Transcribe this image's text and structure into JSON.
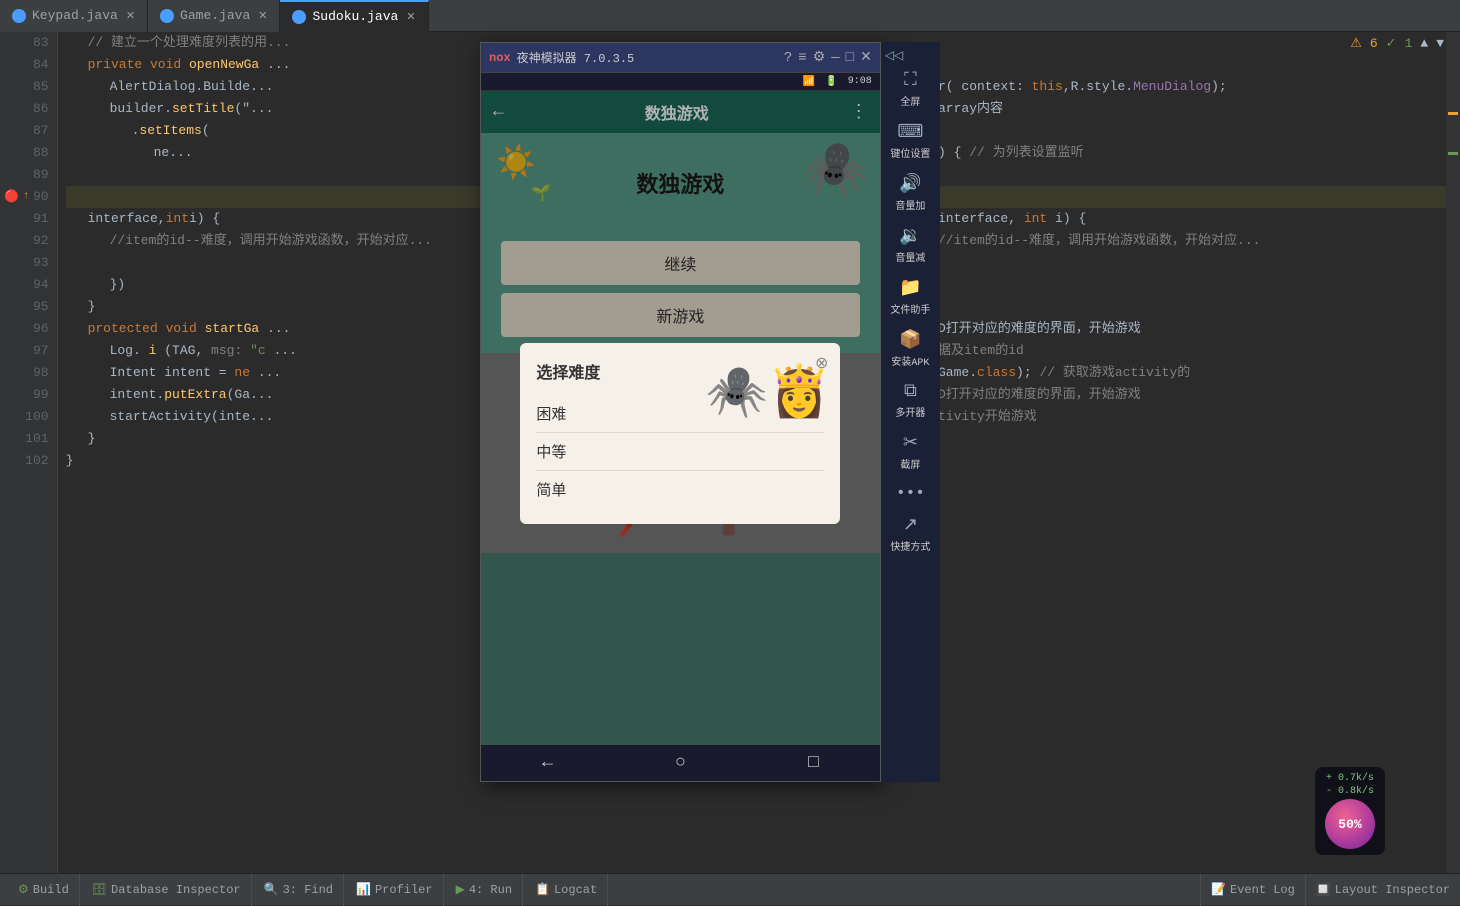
{
  "tabs": [
    {
      "label": "Keypad.java",
      "active": false,
      "id": "keypad"
    },
    {
      "label": "Game.java",
      "active": false,
      "id": "game"
    },
    {
      "label": "Sudoku.java",
      "active": true,
      "id": "sudoku"
    }
  ],
  "code": {
    "lines": [
      {
        "num": 83,
        "content": "    // 建立一个处理难度列表的用...",
        "type": "comment"
      },
      {
        "num": 84,
        "content": "    private void openNewGa...",
        "type": "code"
      },
      {
        "num": 85,
        "content": "        AlertDialog.Builde...",
        "type": "code"
      },
      {
        "num": 86,
        "content": "        builder.setTitle(\"...",
        "type": "code"
      },
      {
        "num": 87,
        "content": "            .setItems(",
        "type": "code"
      },
      {
        "num": 88,
        "content": "                ne...",
        "type": "code"
      },
      {
        "num": 89,
        "content": "",
        "type": "empty"
      },
      {
        "num": 90,
        "content": "",
        "type": "code",
        "highlighted": true
      },
      {
        "num": 91,
        "content": "    interface, int i) {",
        "type": "code"
      },
      {
        "num": 92,
        "content": "            //item的id--难度，调用开始游戏函数，开始对应...",
        "type": "comment"
      },
      {
        "num": 93,
        "content": "",
        "type": "empty"
      },
      {
        "num": 94,
        "content": "            })",
        "type": "code"
      },
      {
        "num": 95,
        "content": "    }",
        "type": "code"
      },
      {
        "num": 96,
        "content": "    protected void startGa...",
        "type": "code"
      },
      {
        "num": 97,
        "content": "        Log.i(TAG,  msg: \"c...",
        "type": "code"
      },
      {
        "num": 98,
        "content": "        Intent intent = ne...",
        "type": "code"
      },
      {
        "num": 99,
        "content": "        intent.putExtra(Ga...",
        "type": "code"
      },
      {
        "num": 100,
        "content": "        startActivity(inte...",
        "type": "code"
      },
      {
        "num": 101,
        "content": "    }",
        "type": "code"
      },
      {
        "num": 102,
        "content": "}",
        "type": "code"
      }
    ]
  },
  "emulator": {
    "title": "夜神模拟器 7.0.3.5",
    "logo": "nox",
    "time": "9:08",
    "app_title": "数独游戏",
    "game_title": "数独游戏",
    "btn_continue": "继续",
    "btn_new_game": "新游戏",
    "dialog_title": "选择难度",
    "difficulties": [
      "困难",
      "中等",
      "简单"
    ],
    "sidebar_items": [
      {
        "label": "全屏",
        "icon": "⛶"
      },
      {
        "label": "键位设置",
        "icon": "⌨"
      },
      {
        "label": "音量加",
        "icon": "🔊"
      },
      {
        "label": "音量减",
        "icon": "🔉"
      },
      {
        "label": "文件助手",
        "icon": "📁"
      },
      {
        "label": "安装APK",
        "icon": "📦"
      },
      {
        "label": "多开器",
        "icon": "⧉"
      },
      {
        "label": "截屏",
        "icon": "✂"
      },
      {
        "label": "...",
        "icon": "•••"
      },
      {
        "label": "快捷方式",
        "icon": "↗"
      }
    ]
  },
  "status_bar": {
    "build_label": "Build",
    "db_inspector_label": "Database Inspector",
    "find_label": "3: Find",
    "profiler_label": "Profiler",
    "run_label": "4: Run",
    "logcat_label": "Logcat",
    "event_log_label": "Event Log",
    "layout_inspector_label": "Layout Inspector",
    "warning_count": "6",
    "ok_count": "1",
    "net_up": "0.7k/s",
    "net_down": "0.8k/s",
    "balloon_label": "50%"
  },
  "right_code": {
    "line91_part1": "interface,",
    "line91_int": "int",
    "line91_part2": "i) {"
  },
  "right_side_code": {
    "line83": "// 建立一个处理难度列表的用",
    "line84_kw": "private void",
    "line84_rest": "openNewGa...",
    "line85": "AlertDialog.Builde",
    "line86": "builder.setTitle(",
    "line87": ".setItems(",
    "line88": "ne...",
    "line90_bullet": "↑",
    "line91_arr": "interface,",
    "line92": "//item的id--难度，调用开始游戏函数，开始对应...",
    "line95": "}",
    "line96_kw": "protected void",
    "line96_rest": "startGa...",
    "line97": "Log.i(TAG,",
    "line98": "Intent intent = ne...",
    "line99": "intent.putExtra(Ga...",
    "line100": "startActivity(inte...",
    "line101": "}",
    "line102": "}"
  }
}
